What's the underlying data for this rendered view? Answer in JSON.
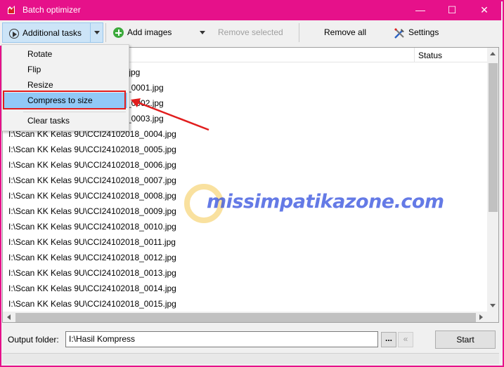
{
  "window": {
    "title": "Batch optimizer",
    "minimize_glyph": "—",
    "maximize_glyph": "☐",
    "close_glyph": "✕"
  },
  "toolbar": {
    "additional_tasks_label": "Additional tasks",
    "add_images_label": "Add images",
    "remove_selected_label": "Remove selected",
    "remove_all_label": "Remove all",
    "settings_label": "Settings"
  },
  "menu": {
    "items": [
      {
        "label": "Rotate"
      },
      {
        "label": "Flip"
      },
      {
        "label": "Resize"
      },
      {
        "label": "Compress to size",
        "selected": true
      },
      {
        "label": "Clear tasks"
      }
    ]
  },
  "list": {
    "status_header": "Status",
    "partial_rows": [
      ".jpg",
      "_0001.jpg",
      "_0002.jpg",
      "_0003.jpg"
    ],
    "rows": [
      "I:\\Scan KK Kelas 9U\\CCI24102018_0004.jpg",
      "I:\\Scan KK Kelas 9U\\CCI24102018_0005.jpg",
      "I:\\Scan KK Kelas 9U\\CCI24102018_0006.jpg",
      "I:\\Scan KK Kelas 9U\\CCI24102018_0007.jpg",
      "I:\\Scan KK Kelas 9U\\CCI24102018_0008.jpg",
      "I:\\Scan KK Kelas 9U\\CCI24102018_0009.jpg",
      "I:\\Scan KK Kelas 9U\\CCI24102018_0010.jpg",
      "I:\\Scan KK Kelas 9U\\CCI24102018_0011.jpg",
      "I:\\Scan KK Kelas 9U\\CCI24102018_0012.jpg",
      "I:\\Scan KK Kelas 9U\\CCI24102018_0013.jpg",
      "I:\\Scan KK Kelas 9U\\CCI24102018_0014.jpg",
      "I:\\Scan KK Kelas 9U\\CCI24102018_0015.jpg"
    ]
  },
  "watermark": {
    "text": "missimpatikazone.com"
  },
  "output": {
    "label": "Output folder:",
    "value": "I:\\Hasil Kompress",
    "browse_label": "...",
    "back_label": "«",
    "start_label": "Start"
  },
  "colors": {
    "titlebar": "#e6118a",
    "menu_selected": "#91c9f7",
    "annotation": "#e11d1d"
  }
}
